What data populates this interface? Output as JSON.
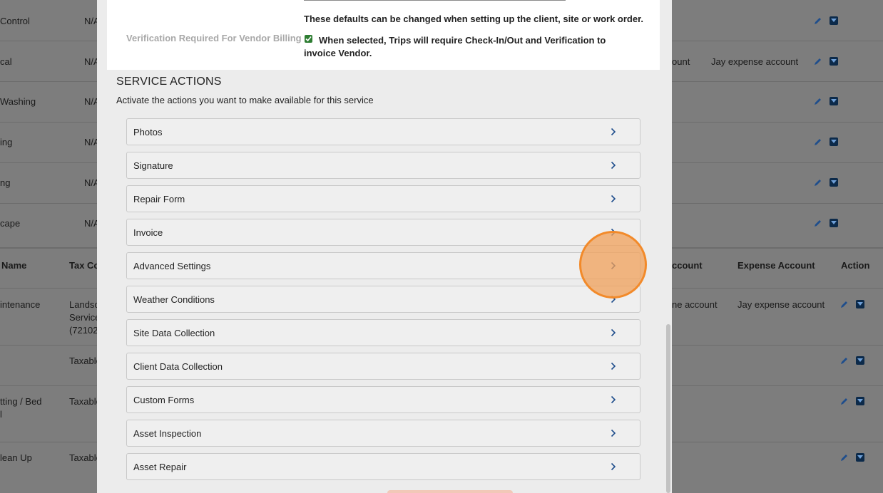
{
  "background_table": {
    "rows_top": [
      {
        "name": "Control",
        "tax": "N/A"
      },
      {
        "name": "cal",
        "tax": "N/A",
        "income": "ount",
        "expense": "Jay expense account"
      },
      {
        "name": "Washing",
        "tax": "N/A"
      },
      {
        "name": "ing",
        "tax": "N/A"
      },
      {
        "name": "ng",
        "tax": "N/A"
      },
      {
        "name": "cape",
        "tax": "N/A"
      }
    ],
    "headers": {
      "name": "Name",
      "tax": "Tax Co",
      "income": "ccount",
      "expense": "Expense Account",
      "action": "Action"
    },
    "rows_bottom": [
      {
        "name": "intenance",
        "tax_lines": [
          "Landsc",
          "Service",
          "(72102"
        ],
        "income": "ne account",
        "expense": "Jay expense account"
      },
      {
        "name": "",
        "tax": "Taxable"
      },
      {
        "name_lines": [
          "tting / Bed",
          "l"
        ],
        "tax": "Taxable"
      },
      {
        "name": "lean Up",
        "tax": "Taxable"
      }
    ]
  },
  "modal": {
    "defaults_note": "These defaults can be changed when setting up the client, site or work order.",
    "vendor_billing": {
      "label": "Verification Required For Vendor Billing",
      "checked": true,
      "text": "When selected, Trips will require Check-In/Out and Verification to invoice Vendor."
    },
    "service_actions": {
      "title": "SERVICE ACTIONS",
      "subtitle": "Activate the actions you want to make available for this service",
      "items": [
        "Photos",
        "Signature",
        "Repair Form",
        "Invoice",
        "Advanced Settings",
        "Weather Conditions",
        "Site Data Collection",
        "Client Data Collection",
        "Custom Forms",
        "Asset Inspection",
        "Asset Repair"
      ]
    }
  },
  "colors": {
    "accent": "#1f4e8c",
    "check": "#2e7d32",
    "highlight": "#f28a2a"
  }
}
